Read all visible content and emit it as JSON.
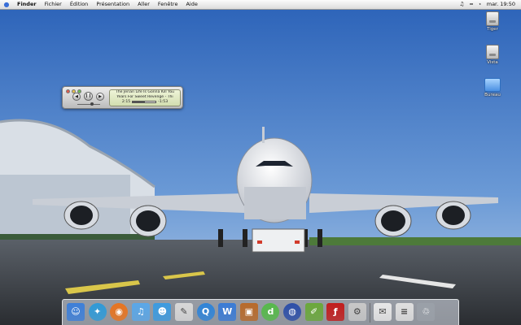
{
  "menubar": {
    "apple_icon": "apple-icon",
    "items": [
      "Finder",
      "Fichier",
      "Édition",
      "Présentation",
      "Aller",
      "Fenêtre",
      "Aide"
    ],
    "clock": "mar. 19:50",
    "status_icons": [
      "volume-icon",
      "wifi-icon",
      "bluetooth-icon"
    ]
  },
  "desktop": {
    "icons": [
      {
        "label": "Tiger",
        "icon": "hard-disk-icon"
      },
      {
        "label": "Vista",
        "icon": "hard-disk-icon"
      },
      {
        "label": "Bureau",
        "icon": "folder-icon"
      }
    ]
  },
  "mini_player": {
    "line1": "The Jerian Life Is Gonna Kill You",
    "line2": "Years For Sweet Revenge - Thi",
    "elapsed": "2:15",
    "remaining": "-1:53",
    "progress": 0.54,
    "volume": 0.6,
    "play_state": "playing"
  },
  "dock": {
    "apps": [
      {
        "name": "finder-icon",
        "color": "#3d7fd9"
      },
      {
        "name": "safari-icon",
        "color": "#2f9ad8"
      },
      {
        "name": "firefox-icon",
        "color": "#e8741f"
      },
      {
        "name": "itunes-icon",
        "color": "#5aa7e8"
      },
      {
        "name": "msn-messenger-icon",
        "color": "#3c9be0"
      },
      {
        "name": "textedit-icon",
        "color": "#d8d8d8"
      },
      {
        "name": "quicktime-icon",
        "color": "#2f84d8"
      },
      {
        "name": "word-icon",
        "color": "#3a7bd5"
      },
      {
        "name": "photo-viewer-icon",
        "color": "#b86a2a"
      },
      {
        "name": "dreamweaver-icon",
        "color": "#56b94a"
      },
      {
        "name": "network-globe-icon",
        "color": "#2d4fa8"
      },
      {
        "name": "dashboard-icon",
        "color": "#6aa83a"
      },
      {
        "name": "flash-icon",
        "color": "#c21d1d"
      },
      {
        "name": "system-preferences-icon",
        "color": "#c8c8c8"
      },
      {
        "name": "mail-icon",
        "color": "#e8e8e8"
      },
      {
        "name": "document-icon",
        "color": "#e0e0e0"
      },
      {
        "name": "trash-icon",
        "color": "#9aa0a8"
      }
    ]
  }
}
